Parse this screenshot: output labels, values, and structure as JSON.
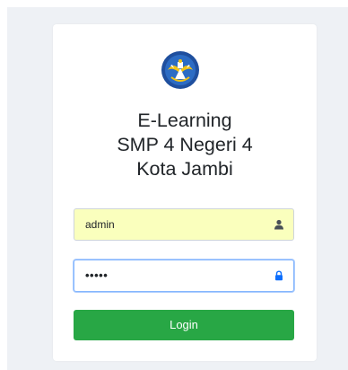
{
  "app": {
    "title_lines": [
      "E-Learning",
      "SMP 4 Negeri 4",
      "Kota Jambi"
    ]
  },
  "form": {
    "username": {
      "value": "admin",
      "icon": "user-icon"
    },
    "password": {
      "masked_value": "•••••",
      "icon": "lock-icon"
    },
    "submit_label": "Login"
  },
  "colors": {
    "background": "#eef1f5",
    "card": "#ffffff",
    "autofill": "#faffbd",
    "focus_border": "#86b7fe",
    "button": "#28a745",
    "lock_icon": "#0d6efd"
  },
  "logo": {
    "icon": "tut-wuri-handayani-logo-icon"
  }
}
